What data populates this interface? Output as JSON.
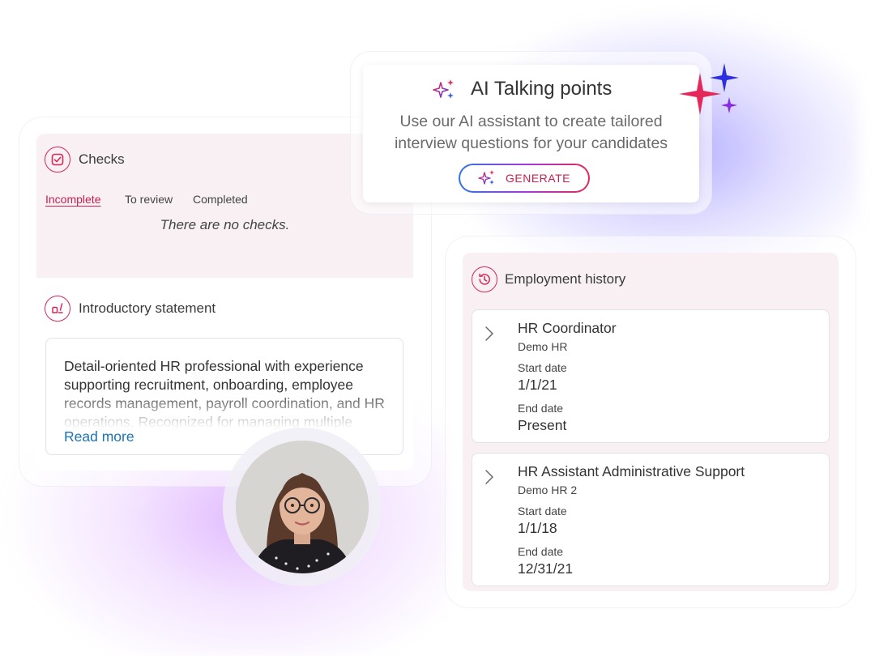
{
  "checks": {
    "title": "Checks",
    "tabs": [
      {
        "label": "Incomplete",
        "active": true
      },
      {
        "label": "To review",
        "active": false
      },
      {
        "label": "Completed",
        "active": false
      }
    ],
    "empty_message": "There are no checks."
  },
  "intro": {
    "title": "Introductory statement",
    "text": "Detail-oriented HR professional with experience supporting recruitment, onboarding, employee records management, payroll coordination, and HR operations. Recognized for managing multiple",
    "read_more": "Read more"
  },
  "ai": {
    "title": "AI Talking points",
    "description_line1": "Use our AI assistant to create tailored",
    "description_line2": "interview questions for your candidates",
    "button": "GENERATE"
  },
  "employment": {
    "title": "Employment history",
    "start_label": "Start date",
    "end_label": "End date",
    "jobs": [
      {
        "title": "HR Coordinator",
        "company": "Demo HR",
        "start": "1/1/21",
        "end": "Present"
      },
      {
        "title": "HR Assistant Administrative Support",
        "company": "Demo HR 2",
        "start": "1/1/18",
        "end": "12/31/21"
      }
    ]
  },
  "colors": {
    "accent": "#d4285a",
    "link": "#1a73b8",
    "panel_tint": "#f8f0f3",
    "gradient_start": "#2f74e8",
    "gradient_mid": "#a33be0",
    "gradient_end": "#e4285a"
  },
  "icons": {
    "checks": "checkbox-icon",
    "intro": "hand-pen-icon",
    "ai": "sparkles-icon",
    "employment": "history-icon",
    "job_expand": "chevron-right-icon"
  }
}
